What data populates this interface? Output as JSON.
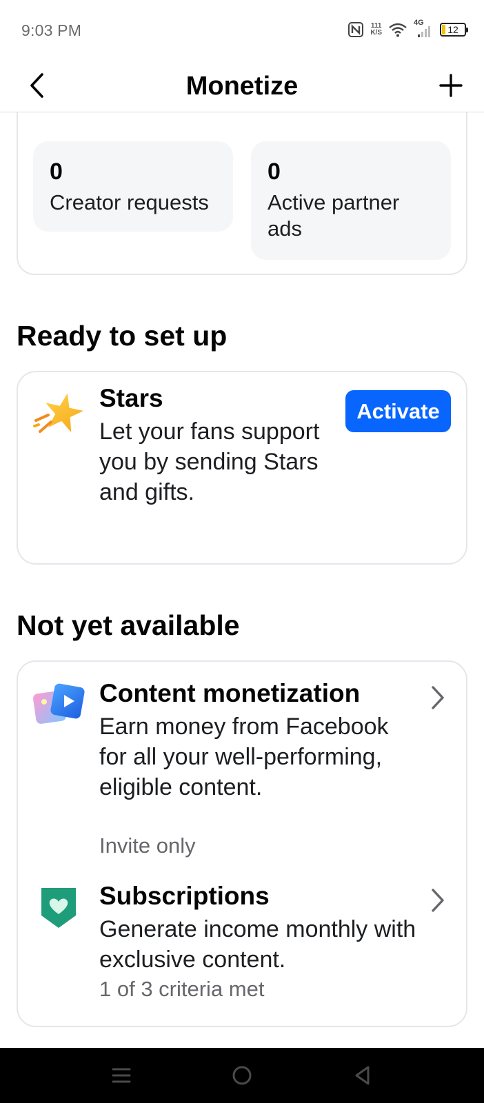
{
  "status_bar": {
    "time": "9:03 PM",
    "speed_value": "111",
    "speed_unit": "K/S",
    "network": "4G",
    "battery": "12"
  },
  "header": {
    "title": "Monetize"
  },
  "stats": [
    {
      "value": "0",
      "label": "Creator requests"
    },
    {
      "value": "0",
      "label": "Active partner ads"
    }
  ],
  "ready_section": {
    "heading": "Ready to set up",
    "items": [
      {
        "icon": "star-icon",
        "title": "Stars",
        "description": "Let your fans support you by sending Stars and gifts.",
        "button_label": "Activate"
      }
    ]
  },
  "not_available_section": {
    "heading": "Not yet available",
    "items": [
      {
        "icon": "content-monetization-icon",
        "title": "Content monetization",
        "description": "Earn money from Facebook for all your well-performing, eligible content.",
        "meta": "Invite only"
      },
      {
        "icon": "subscriptions-heart-icon",
        "title": "Subscriptions",
        "description": "Generate income monthly with exclusive content.",
        "meta": "1 of 3 criteria met"
      }
    ]
  },
  "colors": {
    "accent": "#0866ff",
    "secondary_text": "#65676b",
    "tile_background": "#f5f6f8",
    "subscriptions_green": "#1f9d7a"
  }
}
